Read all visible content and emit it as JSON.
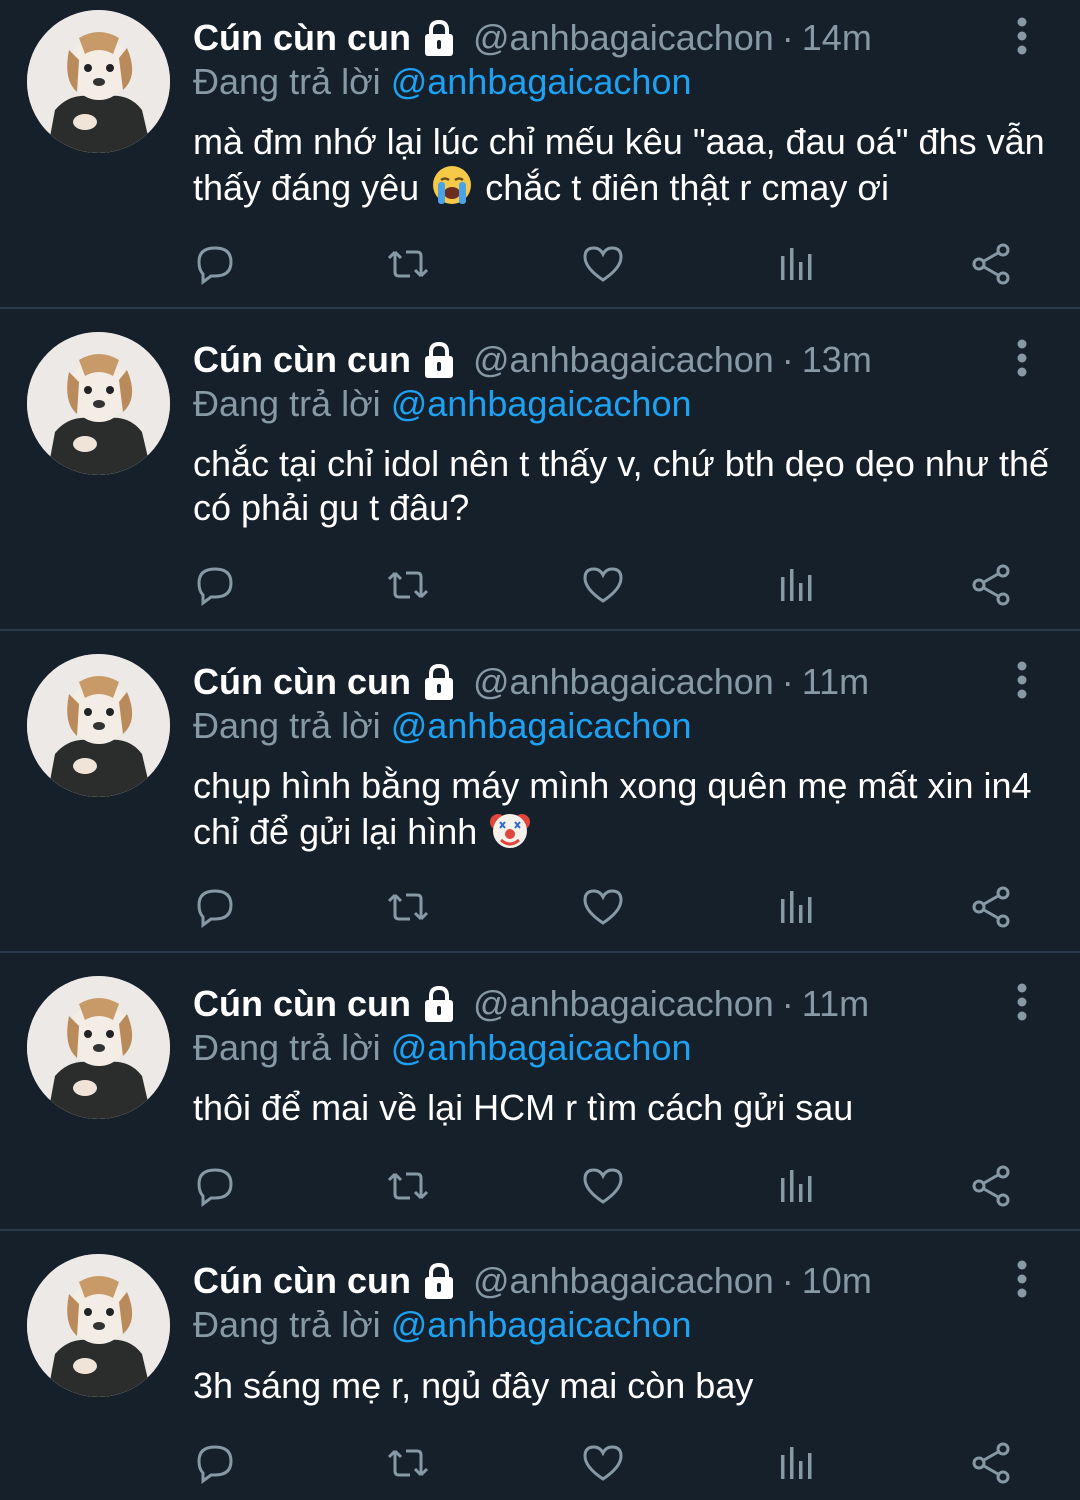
{
  "colors": {
    "background": "#15202b",
    "divider": "#2b3a4a",
    "muted_text": "#8899a6",
    "link": "#1da1f2",
    "icon": "#8899a6"
  },
  "tweets": [
    {
      "display_name": "Cún cùn cun",
      "handle": "@anhbagaicachon",
      "separator": "·",
      "time": "14m",
      "reply_prefix": "Đang trả lời",
      "reply_to": "@anhbagaicachon",
      "text_before_emoji": "mà đm nhớ lại lúc chỉ mếu kêu \"aaa, đau oá\" đhs vẫn thấy đáng yêu",
      "emoji": "loudly-crying-face-emoji",
      "text_after_emoji": "chắc t điên thật r cmay ơi"
    },
    {
      "display_name": "Cún cùn cun",
      "handle": "@anhbagaicachon",
      "separator": "·",
      "time": "13m",
      "reply_prefix": "Đang trả lời",
      "reply_to": "@anhbagaicachon",
      "text_before_emoji": "chắc tại chỉ idol nên t thấy v, chứ bth dẹo dẹo như thế có phải gu t đâu?",
      "emoji": "",
      "text_after_emoji": ""
    },
    {
      "display_name": "Cún cùn cun",
      "handle": "@anhbagaicachon",
      "separator": "·",
      "time": "11m",
      "reply_prefix": "Đang trả lời",
      "reply_to": "@anhbagaicachon",
      "text_before_emoji": "chụp hình bằng máy mình xong quên mẹ mất xin in4 chỉ để gửi lại hình",
      "emoji": "clown-face-emoji",
      "text_after_emoji": ""
    },
    {
      "display_name": "Cún cùn cun",
      "handle": "@anhbagaicachon",
      "separator": "·",
      "time": "11m",
      "reply_prefix": "Đang trả lời",
      "reply_to": "@anhbagaicachon",
      "text_before_emoji": "thôi để mai về lại HCM r tìm cách gửi sau",
      "emoji": "",
      "text_after_emoji": ""
    },
    {
      "display_name": "Cún cùn cun",
      "handle": "@anhbagaicachon",
      "separator": "·",
      "time": "10m",
      "reply_prefix": "Đang trả lời",
      "reply_to": "@anhbagaicachon",
      "text_before_emoji": "3h sáng mẹ r, ngủ đây mai còn bay",
      "emoji": "",
      "text_after_emoji": ""
    }
  ],
  "action_icons": [
    "reply-icon",
    "retweet-icon",
    "like-icon",
    "analytics-icon",
    "share-icon"
  ]
}
